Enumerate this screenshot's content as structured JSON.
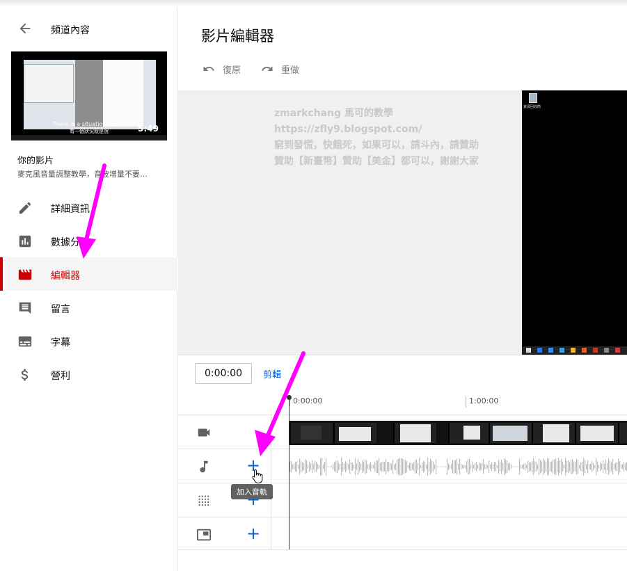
{
  "sidebar": {
    "back_title": "頻道內容",
    "thumbnail": {
      "duration": "5:49",
      "caption_line1": "There is a situation that is",
      "caption_line2": "有一個狀況就是說"
    },
    "your_video_label": "你的影片",
    "video_title": "麥克風音量調整教學，音波增量不要…",
    "items": [
      {
        "label": "詳細資訊",
        "icon": "pencil-icon",
        "active": false
      },
      {
        "label": "數據分析",
        "icon": "analytics-icon",
        "active": false
      },
      {
        "label": "編輯器",
        "icon": "clapperboard-icon",
        "active": true
      },
      {
        "label": "留言",
        "icon": "comment-icon",
        "active": false
      },
      {
        "label": "字幕",
        "icon": "subtitles-icon",
        "active": false
      },
      {
        "label": "營利",
        "icon": "dollar-icon",
        "active": false
      }
    ]
  },
  "main": {
    "title": "影片編輯器",
    "undo_label": "復原",
    "redo_label": "重做",
    "watermark": [
      "zmarkchang 馬可的教學",
      "https://zfly9.blogspot.com/",
      "窮到發慌，快餓死，如果可以，請斗內，請贊助",
      "贊助【新臺幣】贊助【美金】都可以，謝謝大家"
    ],
    "preview_desktop_label": "資源回收筒",
    "time_value": "0:00:00",
    "trim_label": "剪輯",
    "ruler": [
      "0:00:00",
      "1:00:00"
    ],
    "tracks": [
      {
        "name": "video",
        "icon": "video-camera-icon",
        "has_add": false
      },
      {
        "name": "audio",
        "icon": "music-note-icon",
        "has_add": true
      },
      {
        "name": "blur",
        "icon": "blur-grid-icon",
        "has_add": true
      },
      {
        "name": "end-screen",
        "icon": "end-screen-icon",
        "has_add": true
      }
    ],
    "add_symbol": "+",
    "tooltip": "加入音軌"
  },
  "colors": {
    "accent": "#cc0000",
    "link": "#065fd4",
    "annotation_arrow": "#ff00ff"
  }
}
